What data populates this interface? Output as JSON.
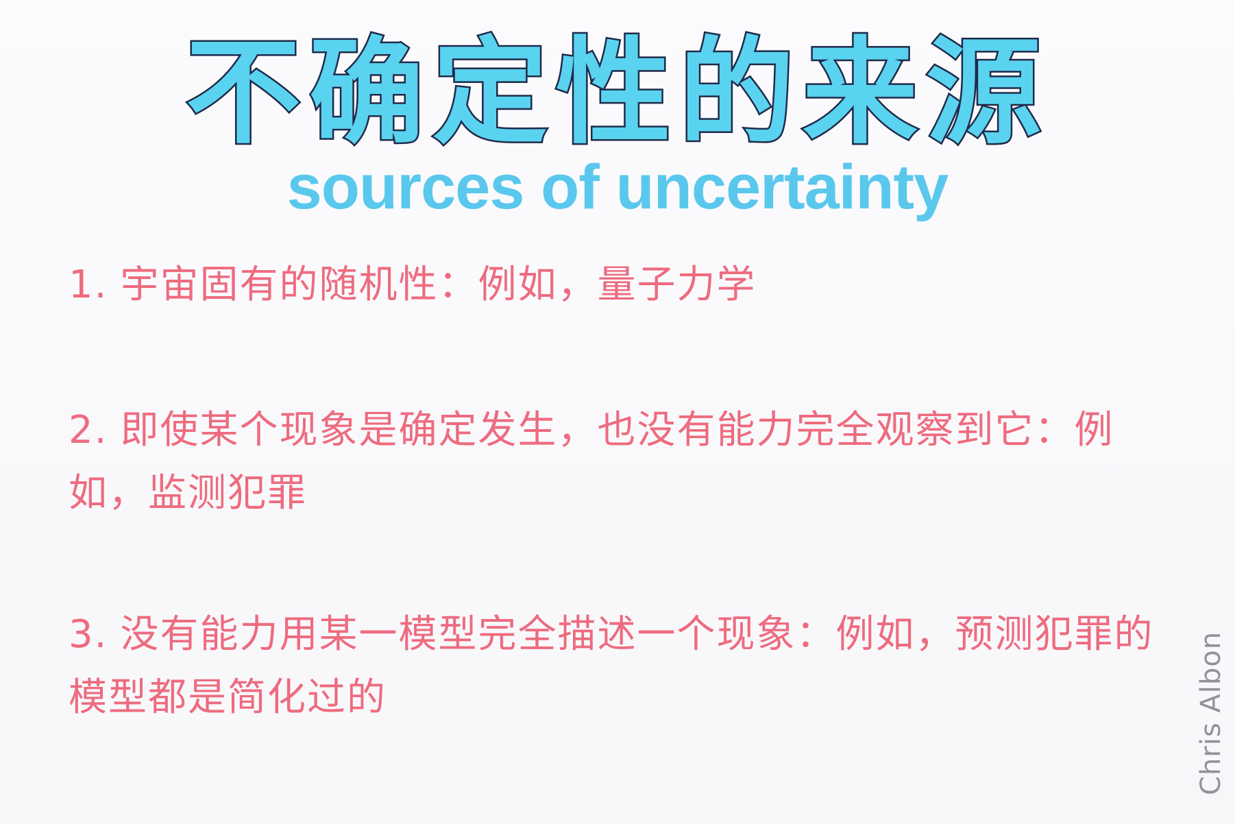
{
  "title_zh": "不确定性的来源",
  "title_en": "sources of uncertainty",
  "items": [
    {
      "number": "1.",
      "text": "宇宙固有的随机性：例如，量子力学"
    },
    {
      "number": "2.",
      "text": "即使某个现象是确定发生，也没有能力完全观察到它：例如，监测犯罪"
    },
    {
      "number": "3.",
      "text": "没有能力用某一模型完全描述一个现象：例如，预测犯罪的模型都是简化过的"
    }
  ],
  "signature": "Chris Albon",
  "colors": {
    "title": "#5ad3f0",
    "subtitle": "#5ac8ec",
    "item_text": "#ee6b7f",
    "signature": "#8f9399",
    "background": "#f9f9fb"
  }
}
